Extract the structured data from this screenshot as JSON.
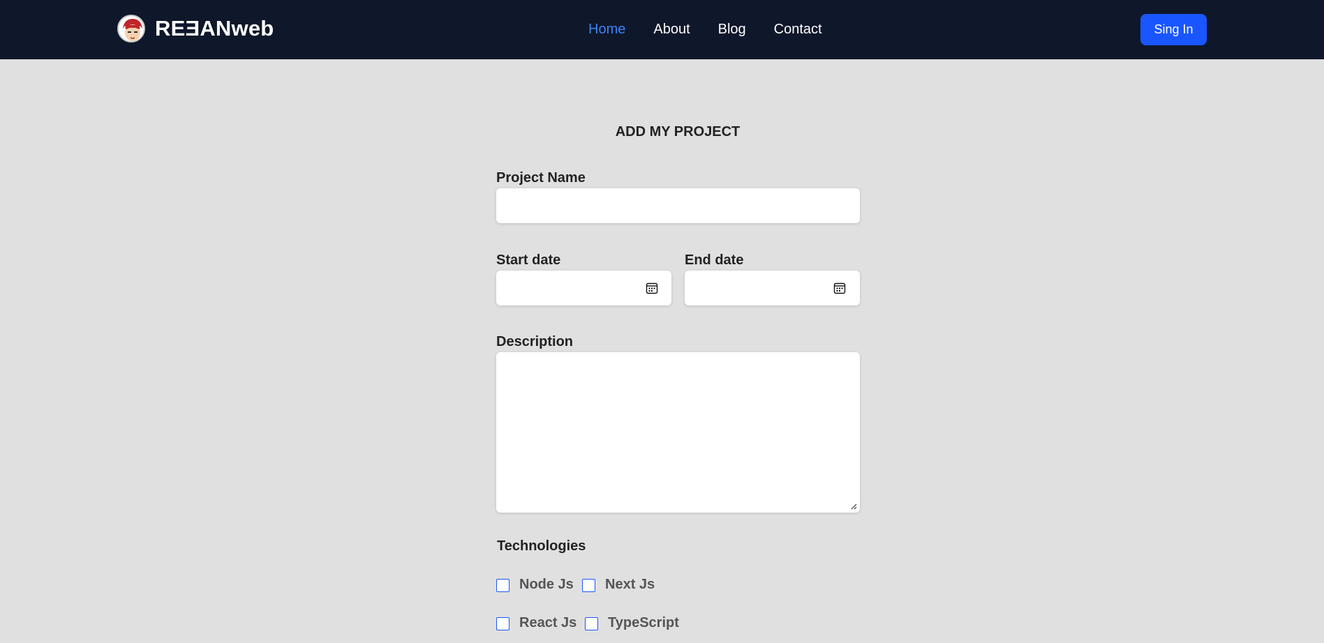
{
  "brand": {
    "name": "REƎANweb"
  },
  "nav": {
    "links": [
      "Home",
      "About",
      "Blog",
      "Contact"
    ],
    "signin_label": "Sing In"
  },
  "form": {
    "title": "ADD MY PROJECT",
    "project_name_label": "Project Name",
    "start_date_label": "Start date",
    "end_date_label": "End date",
    "description_label": "Description",
    "technologies_label": "Technologies",
    "technologies": [
      "Node Js",
      "Next Js",
      "React Js",
      "TypeScript"
    ]
  },
  "colors": {
    "navbar_bg": "#0f172a",
    "active_link": "#3b82f6",
    "button_bg": "#1a56ff",
    "page_bg": "#e0e0e0"
  }
}
